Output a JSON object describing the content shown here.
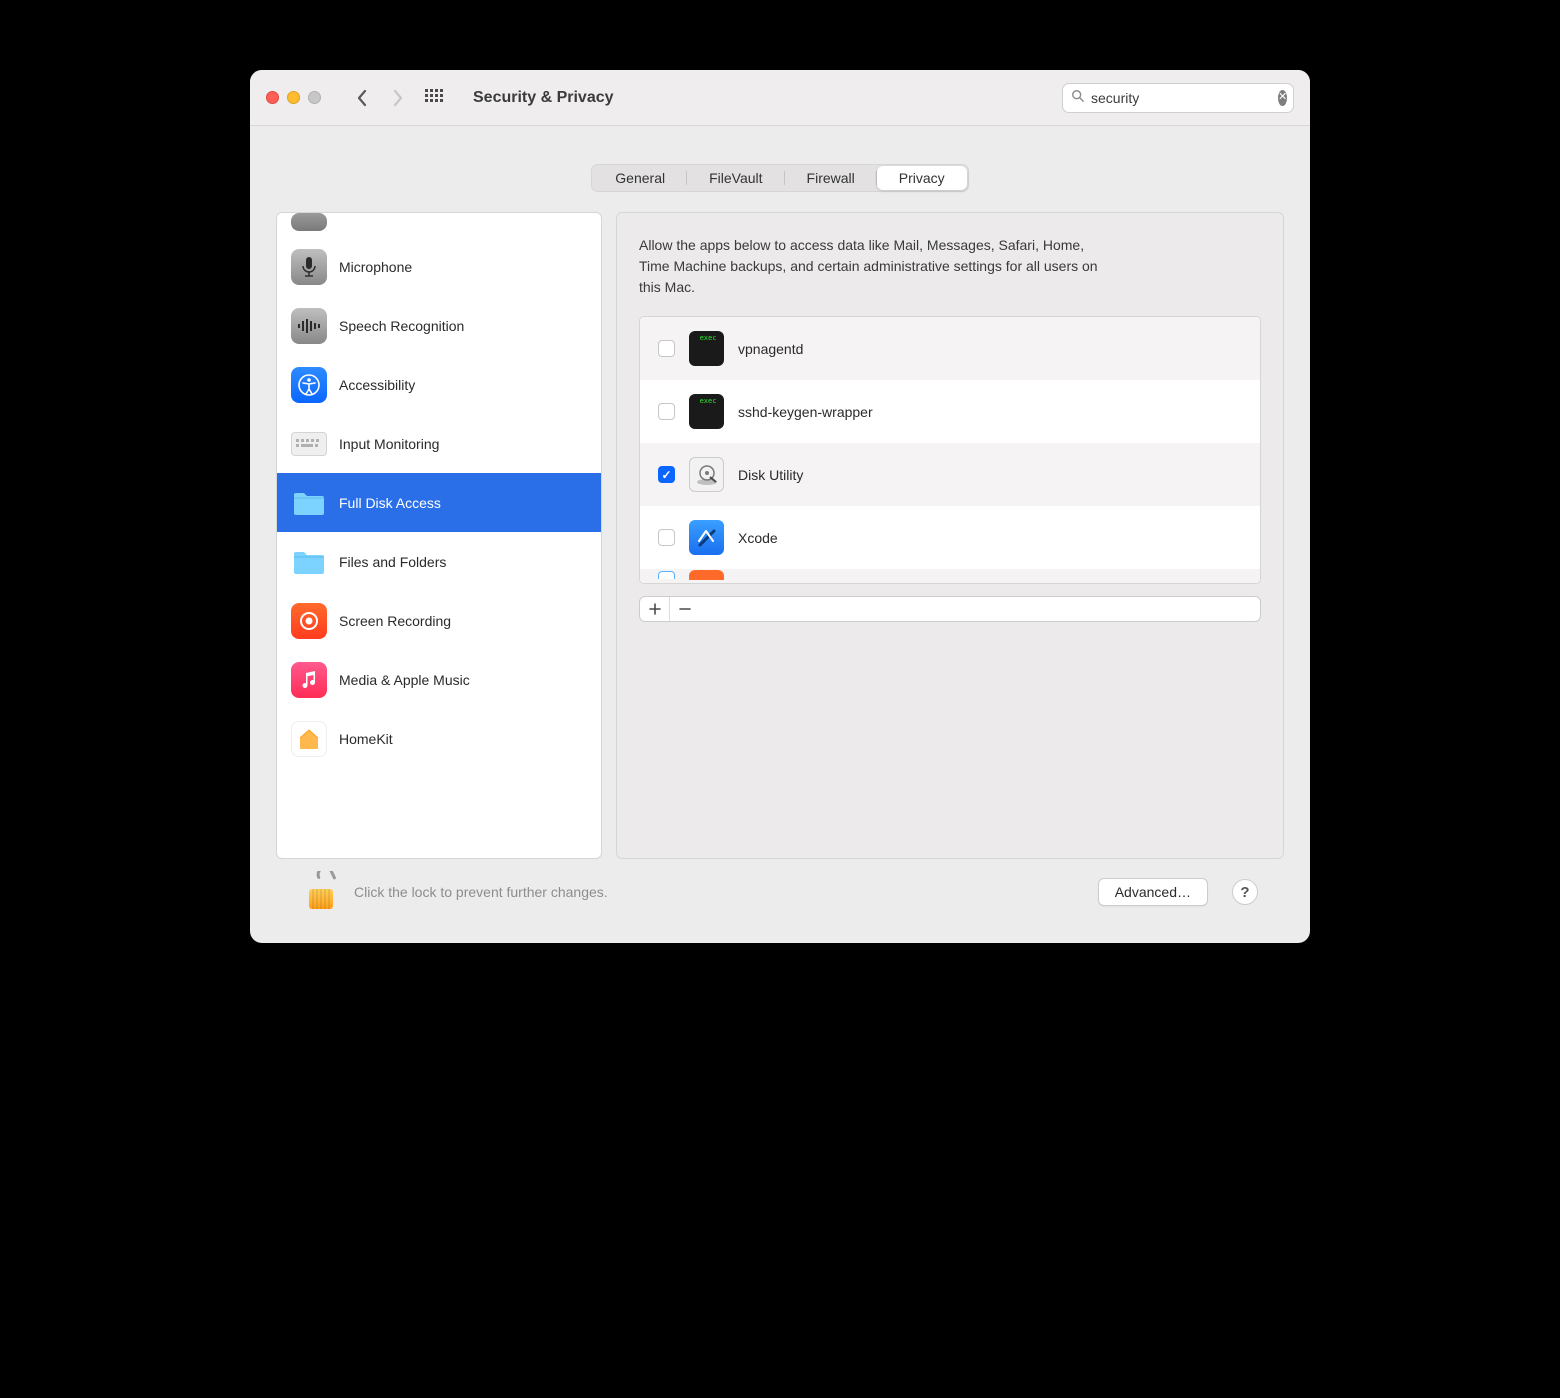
{
  "window": {
    "title": "Security & Privacy"
  },
  "search": {
    "value": "security"
  },
  "tabs": [
    {
      "label": "General",
      "active": false
    },
    {
      "label": "FileVault",
      "active": false
    },
    {
      "label": "Firewall",
      "active": false
    },
    {
      "label": "Privacy",
      "active": true
    }
  ],
  "sidebar": {
    "items": [
      {
        "label": "Microphone",
        "icon": "microphone-icon",
        "selected": false
      },
      {
        "label": "Speech Recognition",
        "icon": "waveform-icon",
        "selected": false
      },
      {
        "label": "Accessibility",
        "icon": "accessibility-icon",
        "selected": false
      },
      {
        "label": "Input Monitoring",
        "icon": "keyboard-icon",
        "selected": false
      },
      {
        "label": "Full Disk Access",
        "icon": "folder-icon",
        "selected": true
      },
      {
        "label": "Files and Folders",
        "icon": "folder-icon",
        "selected": false
      },
      {
        "label": "Screen Recording",
        "icon": "record-icon",
        "selected": false
      },
      {
        "label": "Media & Apple Music",
        "icon": "music-icon",
        "selected": false
      },
      {
        "label": "HomeKit",
        "icon": "home-icon",
        "selected": false
      }
    ]
  },
  "main": {
    "description": "Allow the apps below to access data like Mail, Messages, Safari, Home, Time Machine backups, and certain administrative settings for all users on this Mac.",
    "apps": [
      {
        "name": "vpnagentd",
        "checked": false,
        "icon": "terminal-icon"
      },
      {
        "name": "sshd-keygen-wrapper",
        "checked": false,
        "icon": "terminal-icon"
      },
      {
        "name": "Disk Utility",
        "checked": true,
        "icon": "diskutil-icon"
      },
      {
        "name": "Xcode",
        "checked": false,
        "icon": "xcode-icon"
      }
    ]
  },
  "footer": {
    "lock_message": "Click the lock to prevent further changes.",
    "advanced_label": "Advanced…"
  }
}
